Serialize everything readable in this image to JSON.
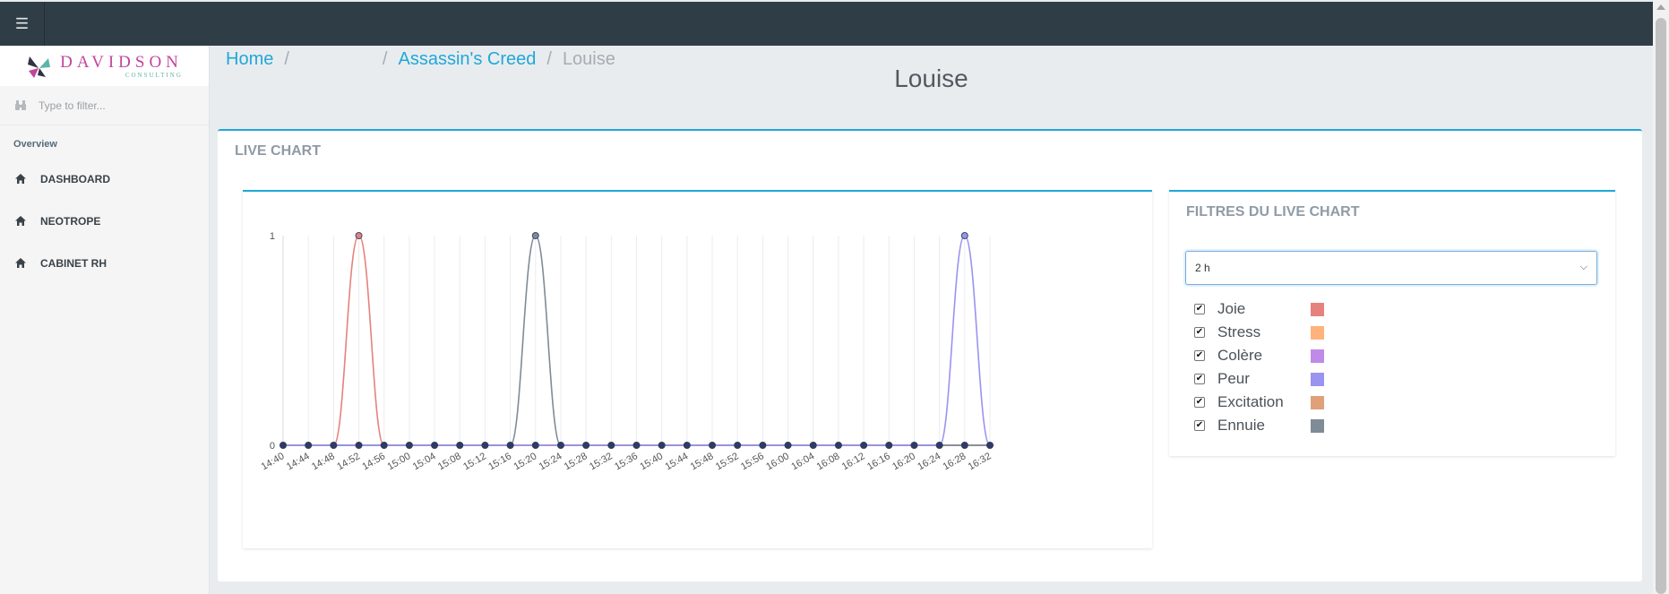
{
  "topbar": {
    "menu_icon": "hamburger-icon",
    "menu_glyph": "☰"
  },
  "sidebar": {
    "logo": {
      "word": "DAVIDSON",
      "sub": "CONSULTING"
    },
    "filter_placeholder": "Type to filter...",
    "section_title": "Overview",
    "items": [
      {
        "label": "DASHBOARD",
        "icon": "home-icon"
      },
      {
        "label": "NEOTROPE",
        "icon": "home-icon"
      },
      {
        "label": "CABINET RH",
        "icon": "home-icon"
      }
    ]
  },
  "breadcrumb": {
    "home": "Home",
    "game": "Assassin's Creed",
    "current": "Louise"
  },
  "page_title": "Louise",
  "card_title": "LIVE CHART",
  "filters": {
    "title": "FILTRES DU LIVE CHART",
    "selected_range": "2 h",
    "emotions": [
      {
        "label": "Joie",
        "color": "#e5827c",
        "checked": true
      },
      {
        "label": "Stress",
        "color": "#ffb27c",
        "checked": true
      },
      {
        "label": "Colère",
        "color": "#c08be8",
        "checked": true
      },
      {
        "label": "Peur",
        "color": "#9a93f0",
        "checked": true
      },
      {
        "label": "Excitation",
        "color": "#dfa07a",
        "checked": true
      },
      {
        "label": "Ennuie",
        "color": "#7f8b96",
        "checked": true
      }
    ]
  },
  "chart_data": {
    "type": "line",
    "x": [
      "14:40",
      "14:44",
      "14:48",
      "14:52",
      "14:56",
      "15:00",
      "15:04",
      "15:08",
      "15:12",
      "15:16",
      "15:20",
      "15:24",
      "15:28",
      "15:32",
      "15:36",
      "15:40",
      "15:44",
      "15:48",
      "15:52",
      "15:56",
      "16:00",
      "16:04",
      "16:08",
      "16:12",
      "16:16",
      "16:20",
      "16:24",
      "16:28",
      "16:32"
    ],
    "ylim": [
      0,
      1
    ],
    "yticks": [
      "0",
      "1"
    ],
    "series": [
      {
        "name": "Joie",
        "color": "#e5827c",
        "values": [
          0,
          0,
          0,
          1,
          0,
          0,
          0,
          0,
          0,
          0,
          0,
          0,
          0,
          0,
          0,
          0,
          0,
          0,
          0,
          0,
          0,
          0,
          0,
          0,
          0,
          0,
          0,
          0,
          0
        ]
      },
      {
        "name": "Ennuie",
        "color": "#7f8b96",
        "values": [
          0,
          0,
          0,
          0,
          0,
          0,
          0,
          0,
          0,
          0,
          1,
          0,
          0,
          0,
          0,
          0,
          0,
          0,
          0,
          0,
          0,
          0,
          0,
          0,
          0,
          0,
          0,
          0,
          0
        ]
      },
      {
        "name": "Peur",
        "color": "#9a93f0",
        "values": [
          0,
          0,
          0,
          0,
          0,
          0,
          0,
          0,
          0,
          0,
          0,
          0,
          0,
          0,
          0,
          0,
          0,
          0,
          0,
          0,
          0,
          0,
          0,
          0,
          0,
          0,
          0,
          1,
          0
        ]
      }
    ],
    "grid": true
  }
}
